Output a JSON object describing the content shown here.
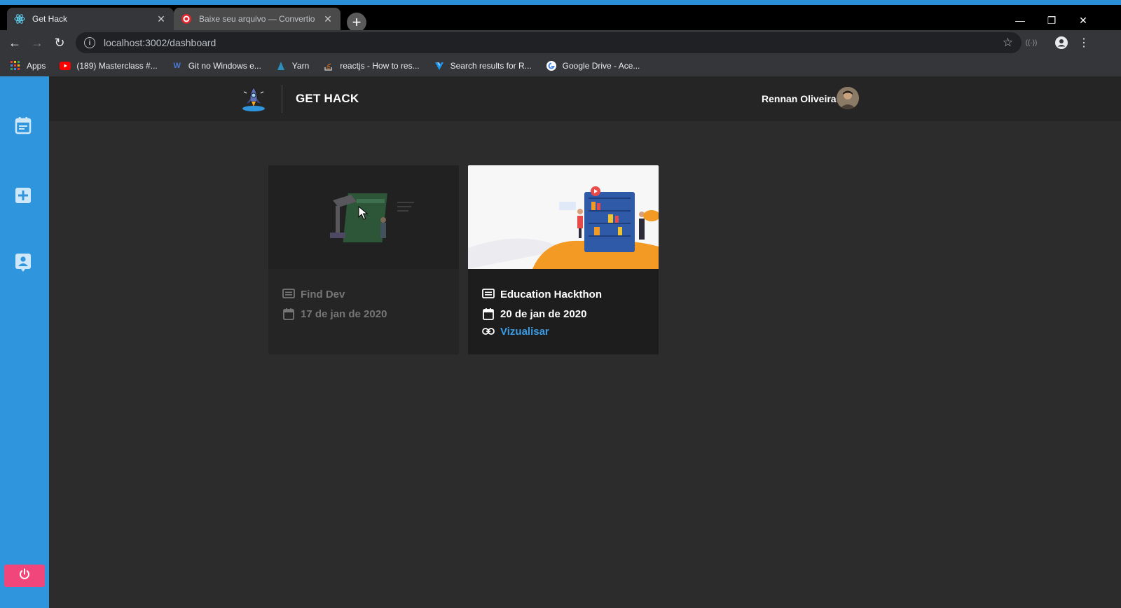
{
  "browser": {
    "tabs": [
      {
        "title": "Get Hack",
        "favicon": "react-icon",
        "active": true
      },
      {
        "title": "Baixe seu arquivo — Convertio",
        "favicon": "convertio-icon",
        "active": false
      }
    ],
    "url": "localhost:3002/dashboard",
    "bookmarks": [
      {
        "label": "Apps",
        "icon": "apps-grid-icon"
      },
      {
        "label": "(189) Masterclass #...",
        "icon": "youtube-icon"
      },
      {
        "label": "Git no Windows e...",
        "icon": "w-icon"
      },
      {
        "label": "Yarn",
        "icon": "yarn-icon"
      },
      {
        "label": "reactjs - How to res...",
        "icon": "stackoverflow-icon"
      },
      {
        "label": "Search results for R...",
        "icon": "vuetify-icon"
      },
      {
        "label": "Google Drive - Ace...",
        "icon": "google-icon"
      }
    ]
  },
  "app": {
    "brand": "GET HACK",
    "user": {
      "name": "Rennan Oliveira"
    },
    "sidebar": [
      {
        "name": "calendar-icon"
      },
      {
        "name": "add-box-icon"
      },
      {
        "name": "contact-icon"
      },
      {
        "name": "power-icon"
      }
    ],
    "cards": [
      {
        "title": "Find Dev",
        "date": "17 de jan de 2020",
        "state": "dimmed"
      },
      {
        "title": "Education Hackthon",
        "date": "20 de jan de 2020",
        "link": "Vizualisar",
        "state": "hover"
      }
    ]
  },
  "colors": {
    "sidebar": "#2f95dc",
    "power_button": "#f0467b",
    "link": "#3a9be4",
    "header": "#252525",
    "background": "#2c2c2c"
  }
}
